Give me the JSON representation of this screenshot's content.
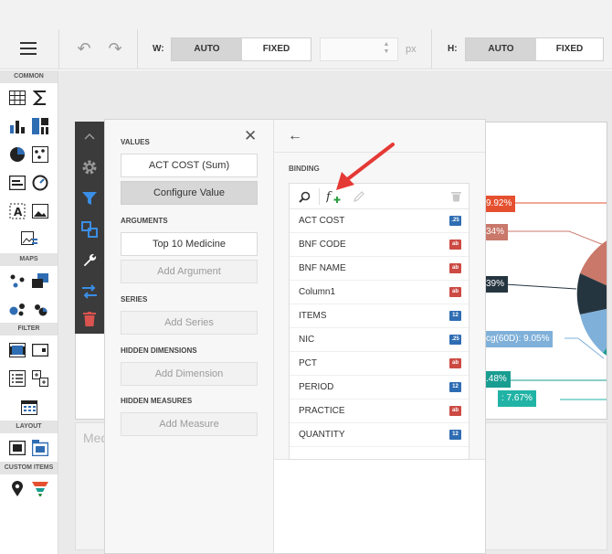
{
  "toolbar": {
    "width_label": "W:",
    "height_label": "H:",
    "auto": "AUTO",
    "fixed": "FIXED",
    "unit": "px"
  },
  "toolbox": {
    "sections": {
      "common": "COMMON",
      "maps": "MAPS",
      "filter": "FILTER",
      "layout": "LAYOUT",
      "custom": "CUSTOM ITEMS"
    }
  },
  "binding_panel": {
    "values_header": "VALUES",
    "value_item": "ACT COST (Sum)",
    "configure_value": "Configure Value",
    "arguments_header": "ARGUMENTS",
    "argument_item": "Top 10 Medicine",
    "add_argument": "Add Argument",
    "series_header": "SERIES",
    "add_series": "Add Series",
    "hidden_dimensions_header": "HIDDEN DIMENSIONS",
    "add_dimension": "Add Dimension",
    "hidden_measures_header": "HIDDEN MEASURES",
    "add_measure": "Add Measure"
  },
  "data_source": {
    "binding_header": "BINDING",
    "fields": [
      {
        "name": "ACT COST",
        "type": ".25"
      },
      {
        "name": "BNF CODE",
        "type": "ab"
      },
      {
        "name": "BNF NAME",
        "type": "ab"
      },
      {
        "name": "Column1",
        "type": "ab"
      },
      {
        "name": "ITEMS",
        "type": "12"
      },
      {
        "name": "NIC",
        "type": ".25"
      },
      {
        "name": "PCT",
        "type": "ab"
      },
      {
        "name": "PERIOD",
        "type": "12"
      },
      {
        "name": "PRACTICE",
        "type": "ab"
      },
      {
        "name": "QUANTITY",
        "type": "12"
      }
    ]
  },
  "chart": {
    "labels": [
      "9.92%",
      "34%",
      "39%",
      "cg(60D): 9.05%",
      ".48%",
      ": 7.67%"
    ],
    "colors": {
      "red": "#e5502f",
      "salmon": "#c9786a",
      "dark": "#253540",
      "lightblue": "#7fb0d9",
      "teal": "#1a9d91",
      "aqua": "#21b3a5"
    }
  },
  "lower_card": {
    "title": "Med"
  },
  "colors": {
    "accent_blue": "#2f6db3",
    "arrow_red": "#e53935"
  }
}
